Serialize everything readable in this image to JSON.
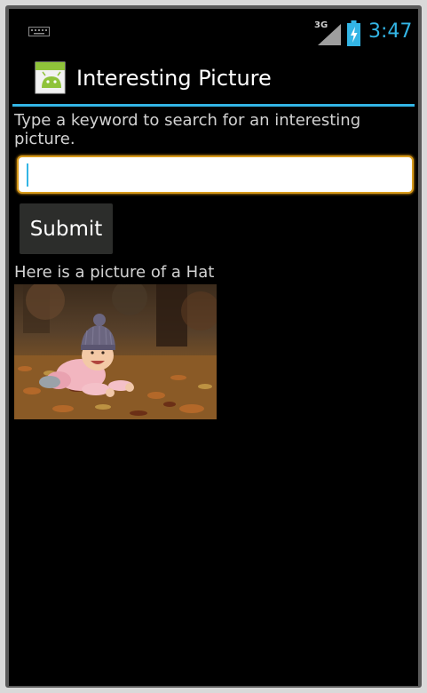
{
  "status_bar": {
    "network": "3G",
    "time": "3:47",
    "icons": [
      "keyboard-icon",
      "signal-icon",
      "battery-charging-icon"
    ],
    "accent_color": "#33b5e5"
  },
  "action_bar": {
    "title": "Interesting Picture",
    "icon": "android-app-icon"
  },
  "main": {
    "prompt": "Type a keyword to search for an interesting picture.",
    "search_value": "",
    "submit_label": "Submit",
    "result_caption": "Here is a picture of a Hat",
    "result_image": "baby-in-knit-hat-photo"
  },
  "colors": {
    "background": "#000000",
    "input_border": "#d89b1c",
    "button": "#2c2d2b"
  }
}
